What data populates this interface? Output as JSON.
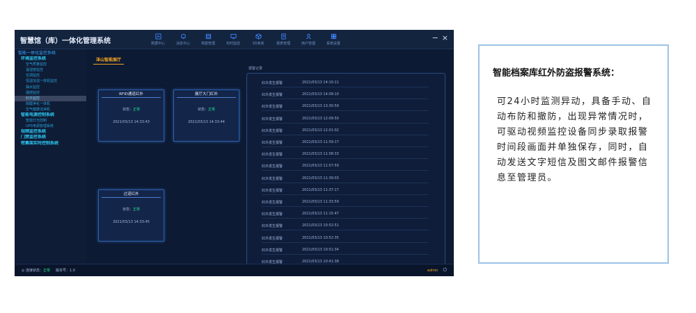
{
  "app": {
    "title": "智慧馆（库）一体化管理系统",
    "nav": [
      {
        "label": "数据中心",
        "icon": "dashboard-icon"
      },
      {
        "label": "消息中心",
        "icon": "bell-icon"
      },
      {
        "label": "档案管理",
        "icon": "archive-icon"
      },
      {
        "label": "实时监控",
        "icon": "monitor-icon"
      },
      {
        "label": "3D库房",
        "icon": "cube-icon"
      },
      {
        "label": "报表管理",
        "icon": "report-icon"
      },
      {
        "label": "用户管理",
        "icon": "user-icon"
      },
      {
        "label": "系统设置",
        "icon": "settings-icon"
      }
    ],
    "window": {
      "minimize": "−",
      "close": "×"
    }
  },
  "sidebar": {
    "items": [
      {
        "label": "智能一体化监控系统",
        "level": 0
      },
      {
        "label": "环境监控系统",
        "level": 1
      },
      {
        "label": "空气质量监控",
        "level": 2
      },
      {
        "label": "温湿度监控",
        "level": 2
      },
      {
        "label": "空调监控",
        "level": 2
      },
      {
        "label": "恒湿加湿一体机监控",
        "level": 2
      },
      {
        "label": "漏水监控",
        "level": 2
      },
      {
        "label": "烟感监控",
        "level": 2
      },
      {
        "label": "红外监控",
        "level": 2,
        "active": true
      },
      {
        "label": "除酸净化一体机",
        "level": 2
      },
      {
        "label": "空气健康洁净机",
        "level": 2
      },
      {
        "label": "智能电源控制系统",
        "level": 1
      },
      {
        "label": "智能灯光控制",
        "level": 2
      },
      {
        "label": "UPS电源管理系统",
        "level": 2
      },
      {
        "label": "视频监控系统",
        "level": 1
      },
      {
        "label": "门禁监控系统",
        "level": 1
      },
      {
        "label": "密集架实时控制系统",
        "level": 1
      }
    ]
  },
  "tab": {
    "label": "泽山智能展厅"
  },
  "cards": [
    {
      "name": "RFID通道红外",
      "status_label": "状态：",
      "status": "正常",
      "time": "2021/03/13 14:33:43"
    },
    {
      "name": "展厅大门红外",
      "status_label": "状态：",
      "status": "正常",
      "time": "2021/03/13 14:33:44"
    },
    {
      "name": "过道红外",
      "status_label": "状态：",
      "status": "正常",
      "time": "2021/03/13 14:33:45"
    }
  ],
  "alarm_panel": {
    "title": "报警记录",
    "rows": [
      {
        "event": "红外发生报警",
        "time": "2021/03/13 14:10:11"
      },
      {
        "event": "红外发生报警",
        "time": "2021/03/13 14:09:10"
      },
      {
        "event": "红外发生报警",
        "time": "2021/03/13 13:30:59"
      },
      {
        "event": "红外发生报警",
        "time": "2021/03/13 12:09:50"
      },
      {
        "event": "红外发生报警",
        "time": "2021/03/13 12:01:02"
      },
      {
        "event": "红外发生报警",
        "time": "2021/03/13 11:59:17"
      },
      {
        "event": "红外发生报警",
        "time": "2021/03/13 11:58:33"
      },
      {
        "event": "红外发生报警",
        "time": "2021/03/13 11:57:59"
      },
      {
        "event": "红外发生报警",
        "time": "2021/03/13 11:39:03"
      },
      {
        "event": "红外发生报警",
        "time": "2021/03/13 11:37:17"
      },
      {
        "event": "红外发生报警",
        "time": "2021/03/13 11:33:59"
      },
      {
        "event": "红外发生报警",
        "time": "2021/03/13 11:15:47"
      },
      {
        "event": "红外发生报警",
        "time": "2021/03/13 10:52:51"
      },
      {
        "event": "红外发生报警",
        "time": "2021/03/13 10:52:35"
      },
      {
        "event": "红外发生报警",
        "time": "2021/03/13 10:51:34"
      },
      {
        "event": "红外发生报警",
        "time": "2021/03/13 10:41:38"
      }
    ]
  },
  "statusbar": {
    "connection_label": "连接状态：",
    "connection_value": "正常",
    "version_label": "版本号：",
    "version_value": "1.0",
    "user": "admin"
  },
  "description": {
    "title": "智能档案库红外防盗报警系统：",
    "body": "可24小时监测异动，具备手动、自动布防和撤防，出现异常情况时，可驱动视频监控设备同步录取报警时间段画面并单独保存，同时，自动发送文字短信及图文邮件报警信息至管理员。"
  }
}
